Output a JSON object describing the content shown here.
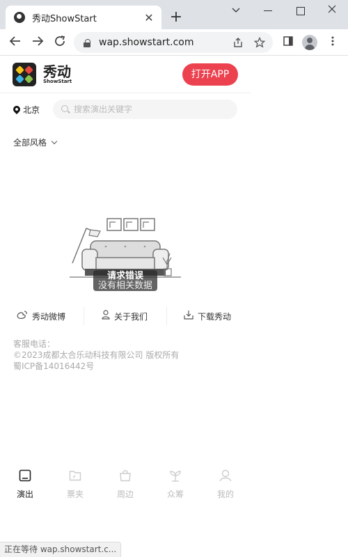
{
  "browser": {
    "tab_title": "秀动ShowStart",
    "tab_close": "✕",
    "new_tab": "+",
    "url": "wap.showstart.com",
    "status": "正在等待 wap.showstart.c..."
  },
  "header": {
    "brand_cn": "秀动",
    "brand_en": "ShowStart",
    "open_app": "打开APP"
  },
  "search": {
    "city": "北京",
    "placeholder": "搜索演出关键字"
  },
  "filter": {
    "label": "全部风格"
  },
  "toast": {
    "title": "请求错误",
    "message": "没有相关数据"
  },
  "links": [
    {
      "label": "秀动微博",
      "icon": "weibo-icon"
    },
    {
      "label": "关于我们",
      "icon": "user-icon"
    },
    {
      "label": "下载秀动",
      "icon": "download-icon"
    }
  ],
  "footer": {
    "phone_label": "客服电话：",
    "copyright": "©2023成都太合乐动科技有限公司 版权所有",
    "icp": "蜀ICP备14016442号"
  },
  "bottom_nav": [
    {
      "label": "演出",
      "icon": "show-icon",
      "active": true
    },
    {
      "label": "票夹",
      "icon": "ticket-folder-icon",
      "active": false
    },
    {
      "label": "周边",
      "icon": "shopping-bag-icon",
      "active": false
    },
    {
      "label": "众筹",
      "icon": "sprout-icon",
      "active": false
    },
    {
      "label": "我的",
      "icon": "profile-icon",
      "active": false
    }
  ],
  "colors": {
    "accent": "#ec414e",
    "chrome_bg": "#dee1e6",
    "omnibox_bg": "#f1f3f4"
  }
}
